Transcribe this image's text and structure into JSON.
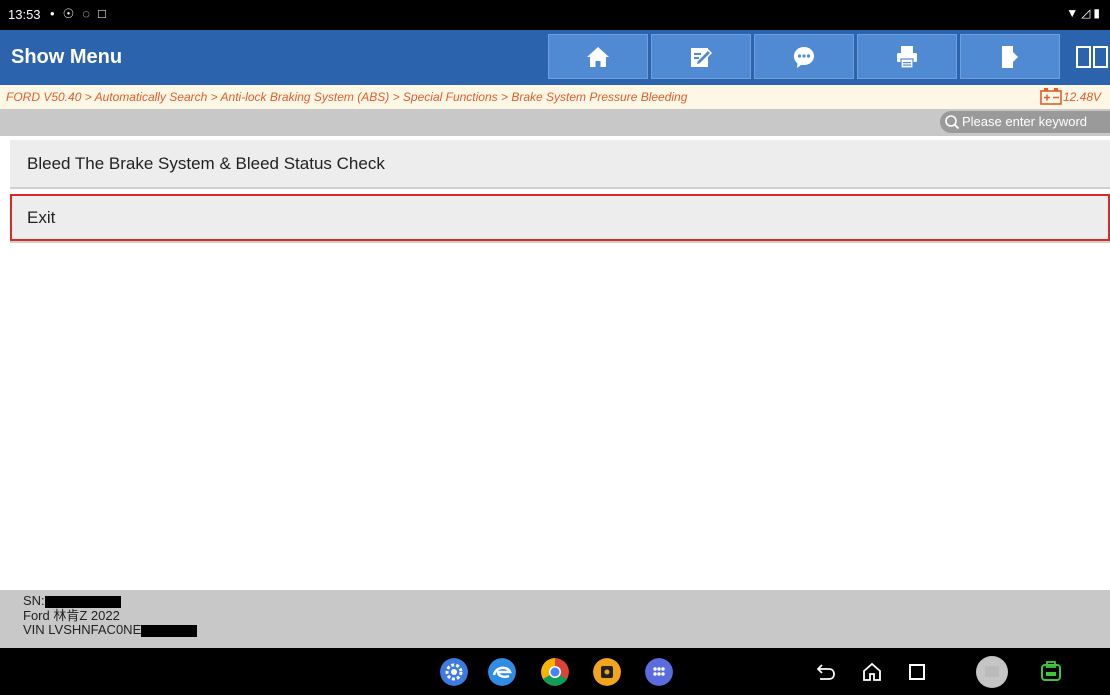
{
  "status_bar": {
    "time": "13:53"
  },
  "header": {
    "title": "Show Menu",
    "toolbar_icons": [
      "home-icon",
      "edit-report-icon",
      "chat-icon",
      "print-icon",
      "exit-door-icon"
    ],
    "split_view_icon": "split-view-icon"
  },
  "breadcrumb": {
    "path": "FORD V50.40 > Automatically Search > Anti-lock Braking System (ABS) > Special Functions > Brake System Pressure Bleeding",
    "battery_voltage": "12.48V"
  },
  "search": {
    "placeholder": "Please enter keyword"
  },
  "menu": {
    "items": [
      {
        "label": "Bleed The Brake System & Bleed Status Check"
      },
      {
        "label": "Exit",
        "selected": true
      }
    ]
  },
  "vehicle_info": {
    "sn_label": "SN:",
    "model": "Ford 林肯Z 2022",
    "vin_prefix": "VIN LVSHNFAC0NE"
  },
  "nav_bar": {
    "apps": [
      "settings-app-icon",
      "browser-app-icon",
      "chrome-app-icon",
      "launch-app-icon",
      "app-drawer-icon"
    ],
    "buttons": [
      "back-icon",
      "home-nav-icon",
      "recents-icon",
      "gallery-icon",
      "vci-icon"
    ]
  },
  "colors": {
    "header_blue": "#2b64ad",
    "button_blue": "#4f8ad2",
    "breadcrumb_orange": "#e25c2c",
    "selection_red": "#d72b2b"
  }
}
